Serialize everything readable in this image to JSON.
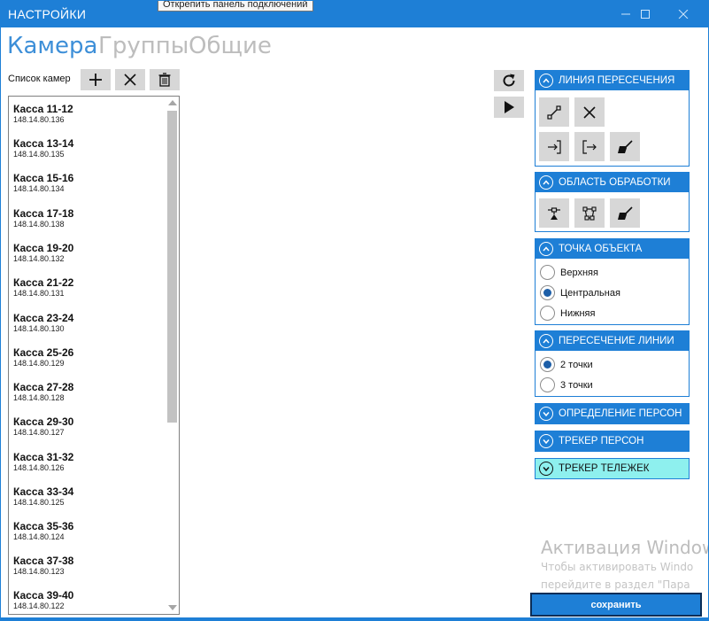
{
  "window": {
    "title": "НАСТРОЙКИ",
    "tooltip": "Открепить панель подключений"
  },
  "tabs": [
    {
      "label": "Камера",
      "active": true
    },
    {
      "label": "Группы",
      "active": false
    },
    {
      "label": "Общие",
      "active": false
    }
  ],
  "camera_list": {
    "label": "Список камер",
    "items": [
      {
        "name": "Касса 11-12",
        "ip": "148.14.80.136"
      },
      {
        "name": "Касса 13-14",
        "ip": "148.14.80.135"
      },
      {
        "name": "Касса 15-16",
        "ip": "148.14.80.134"
      },
      {
        "name": "Касса 17-18",
        "ip": "148.14.80.138"
      },
      {
        "name": "Касса 19-20",
        "ip": "148.14.80.132"
      },
      {
        "name": "Касса 21-22",
        "ip": "148.14.80.131"
      },
      {
        "name": "Касса 23-24",
        "ip": "148.14.80.130"
      },
      {
        "name": "Касса 25-26",
        "ip": "148.14.80.129"
      },
      {
        "name": "Касса 27-28",
        "ip": "148.14.80.128"
      },
      {
        "name": "Касса 29-30",
        "ip": "148.14.80.127"
      },
      {
        "name": "Касса 31-32",
        "ip": "148.14.80.126"
      },
      {
        "name": "Касса 33-34",
        "ip": "148.14.80.125"
      },
      {
        "name": "Касса 35-36",
        "ip": "148.14.80.124"
      },
      {
        "name": "Касса 37-38",
        "ip": "148.14.80.123"
      },
      {
        "name": "Касса 39-40",
        "ip": "148.14.80.122"
      }
    ]
  },
  "panels": {
    "crossing_line": {
      "title": "ЛИНИЯ ПЕРЕСЕЧЕНИЯ"
    },
    "processing_area": {
      "title": "ОБЛАСТЬ ОБРАБОТКИ"
    },
    "object_point": {
      "title": "ТОЧКА ОБЪЕКТА",
      "options": [
        "Верхняя",
        "Центральная",
        "Нижняя"
      ],
      "selected": "Центральная"
    },
    "line_crossing": {
      "title": "ПЕРЕСЕЧЕНИЕ ЛИНИИ",
      "options": [
        "2 точки",
        "3 точки"
      ],
      "selected": "2 точки"
    },
    "person_detection": {
      "title": "ОПРЕДЕЛЕНИЕ ПЕРСОН"
    },
    "person_tracker": {
      "title": "ТРЕКЕР ПЕРСОН"
    },
    "cart_tracker": {
      "title": "ТРЕКЕР ТЕЛЕЖЕК"
    }
  },
  "watermark": {
    "line1": "Активация Windows",
    "line2": "Чтобы активировать Windo",
    "line3": "перейдите в раздел \"Пара"
  },
  "save_label": "сохранить",
  "colors": {
    "accent": "#1e7fd6",
    "tab_active": "#3d8fd8",
    "tab_inactive": "#bdbdbd",
    "highlight_panel": "#8ef0ee"
  }
}
